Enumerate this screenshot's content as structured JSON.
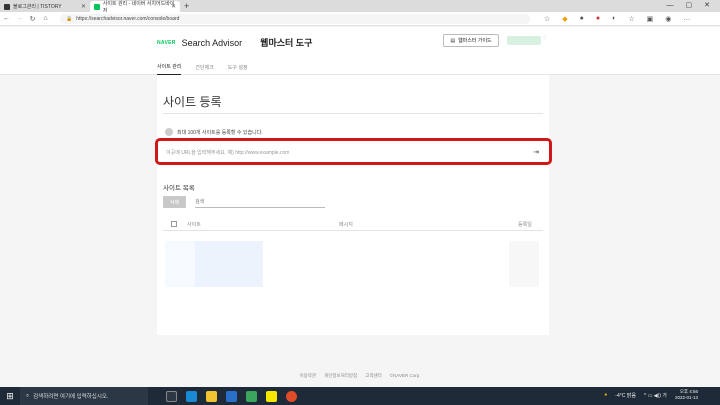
{
  "browser": {
    "tabs": [
      {
        "label": "블로그관리 | TISTORY",
        "active": false
      },
      {
        "label": "사이트 관리 - 네이버 서치어드바이저",
        "active": true
      }
    ],
    "new_tab": "+",
    "window_controls": [
      "—",
      "▢",
      "✕"
    ],
    "url": "https://searchadvisor.naver.com/console/board"
  },
  "header": {
    "naver_logo": "NAVER",
    "title": "Search Advisor",
    "tool_title": "웹마스터 도구",
    "guide_button": "웹마스터 가이드"
  },
  "menu": [
    "사이트 관리",
    "간단체크",
    "도구 설정"
  ],
  "main": {
    "heading": "사이트 등록",
    "info_text": "최대 100개 사이트를 등록할 수 있습니다.",
    "url_placeholder": "이곳에 URL을 입력해주세요. 예) http://www.example.com",
    "list_heading": "사이트 목록",
    "delete_button": "삭제",
    "search_placeholder": "검색",
    "columns": [
      "사이트",
      "메시지",
      "등록일"
    ]
  },
  "footer": [
    "이용약관",
    "개인정보처리방침",
    "고객센터",
    "©NAVER Corp."
  ],
  "taskbar": {
    "search_placeholder": "검색하려면 여기에 입력하십시오.",
    "weather": "-4°C 맑음",
    "time": "오후 4:56",
    "date": "2022-01-13"
  }
}
